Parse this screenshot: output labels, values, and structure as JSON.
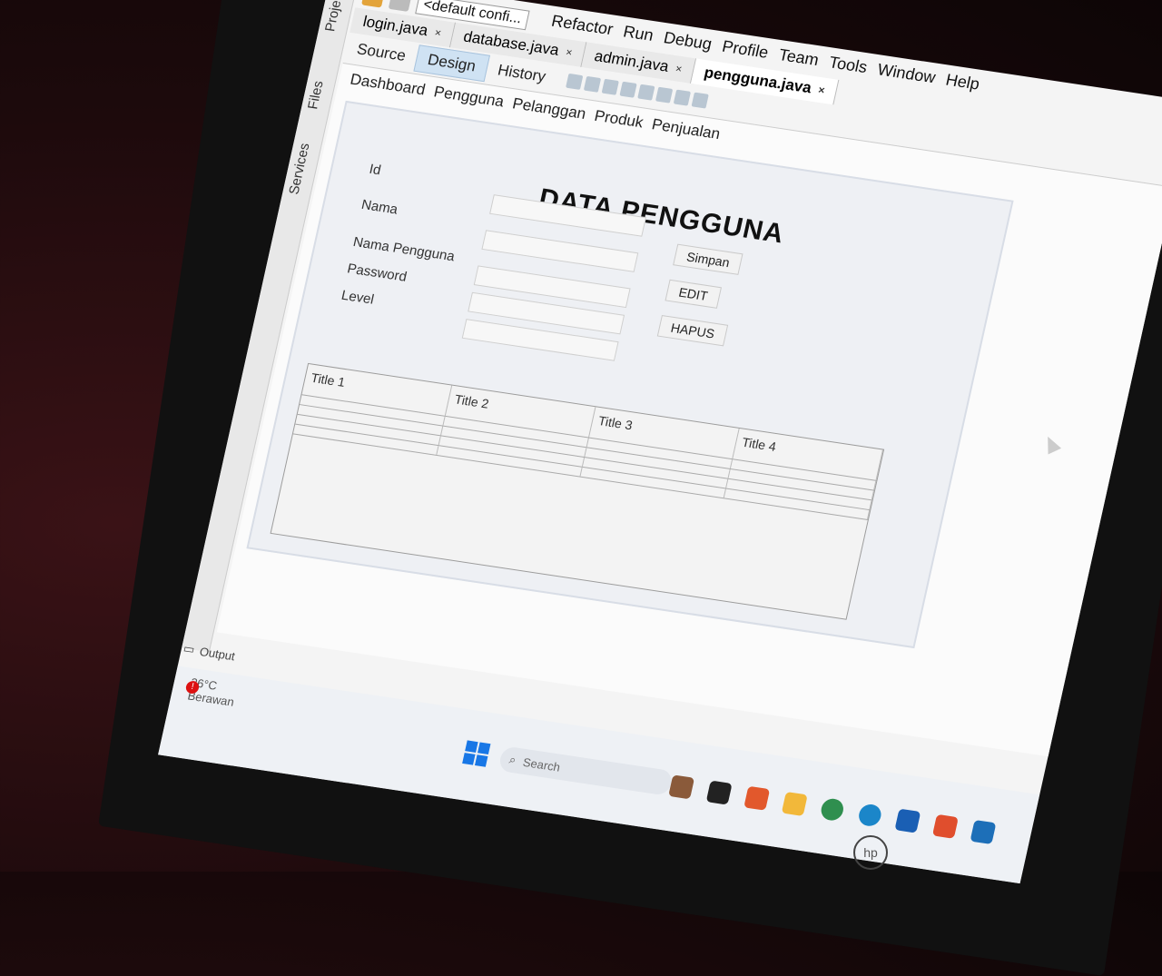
{
  "menu": [
    "Refactor",
    "Run",
    "Debug",
    "Profile",
    "Team",
    "Tools",
    "Window",
    "Help"
  ],
  "config_select": "<default confi...",
  "file_tabs": [
    {
      "label": "login.java",
      "close": "×"
    },
    {
      "label": "database.java",
      "close": "×"
    },
    {
      "label": "admin.java",
      "close": "×"
    },
    {
      "label": "pengguna.java",
      "close": "×"
    }
  ],
  "view_tabs": [
    "Source",
    "Design",
    "History"
  ],
  "side_tabs": [
    "Projects",
    "Files",
    "Services"
  ],
  "nav_menu": [
    "Dashboard",
    "Pengguna",
    "Pelanggan",
    "Produk",
    "Penjualan"
  ],
  "form": {
    "title": "DATA PENGGUNA",
    "labels": [
      "Id",
      "Nama",
      "Nama Pengguna",
      "Password",
      "Level"
    ],
    "buttons": {
      "save": "Simpan",
      "edit": "EDIT",
      "delete": "HAPUS"
    }
  },
  "table": {
    "columns": [
      "Title 1",
      "Title 2",
      "Title 3",
      "Title 4"
    ],
    "empty_rows": 4
  },
  "bottom": {
    "output_label": "Output"
  },
  "taskbar": {
    "temperature": "26°C",
    "weather": "Berawan",
    "search_placeholder": "Search",
    "alert_count": "!"
  },
  "laptop_logo": "hp",
  "colors": {
    "selected_tab": "#cfe2f3",
    "start": "#1877e6",
    "alert": "#d11111"
  }
}
